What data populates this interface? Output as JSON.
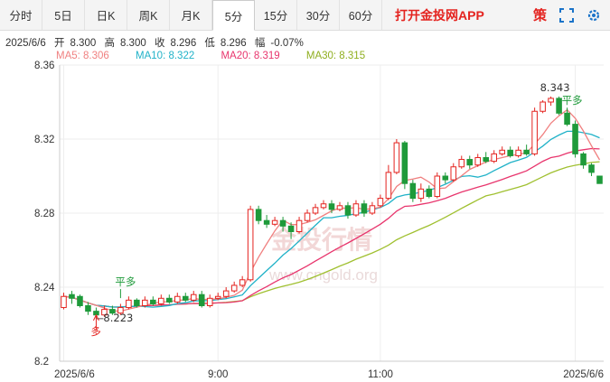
{
  "tabs": [
    {
      "label": "分时"
    },
    {
      "label": "5日"
    },
    {
      "label": "日K"
    },
    {
      "label": "周K"
    },
    {
      "label": "月K"
    },
    {
      "label": "5分",
      "active": true
    },
    {
      "label": "15分"
    },
    {
      "label": "30分"
    },
    {
      "label": "60分"
    }
  ],
  "promo": "打开金投网APP",
  "toolbar": {
    "strategy_label": "策",
    "icons": [
      "fullscreen-icon",
      "settings-icon"
    ]
  },
  "info": {
    "date": "2025/6/6",
    "open_label": "开",
    "open": "8.300",
    "high_label": "高",
    "high": "8.300",
    "close_label": "收",
    "close": "8.296",
    "low_label": "低",
    "low": "8.296",
    "change_label": "幅",
    "change": "-0.07%"
  },
  "ma": {
    "ma5": "MA5: 8.306",
    "ma10": "MA10: 8.322",
    "ma20": "MA20: 8.319",
    "ma30": "MA30: 8.315",
    "colors": {
      "ma5": "#f08080",
      "ma10": "#20b2c8",
      "ma20": "#e8356d",
      "ma30": "#a0c030"
    }
  },
  "watermark": {
    "text": "金投行情",
    "url": "www.cngold.org"
  },
  "chart_data": {
    "type": "candlestick",
    "ylim": [
      8.2,
      8.36
    ],
    "yticks": [
      "8.36",
      "8.32",
      "8.28",
      "8.24",
      "8.2"
    ],
    "xticks": [
      {
        "label": "2025/6/6",
        "index": 0
      },
      {
        "label": "9:00",
        "index": 19
      },
      {
        "label": "11:00",
        "index": 39
      },
      {
        "label": "2025/6/6",
        "index": 63
      }
    ],
    "up_color": "#e4231f",
    "down_color": "#1e9a3a",
    "candles": [
      [
        8.229,
        8.235,
        8.237,
        8.228
      ],
      [
        8.236,
        8.234,
        8.238,
        8.231
      ],
      [
        8.235,
        8.23,
        8.236,
        8.229
      ],
      [
        8.23,
        8.227,
        8.232,
        8.225
      ],
      [
        8.227,
        8.225,
        8.229,
        8.223
      ],
      [
        8.225,
        8.228,
        8.23,
        8.224
      ],
      [
        8.228,
        8.226,
        8.23,
        8.225
      ],
      [
        8.226,
        8.229,
        8.231,
        8.225
      ],
      [
        8.229,
        8.233,
        8.235,
        8.228
      ],
      [
        8.233,
        8.23,
        8.234,
        8.229
      ],
      [
        8.23,
        8.233,
        8.235,
        8.229
      ],
      [
        8.233,
        8.231,
        8.235,
        8.23
      ],
      [
        8.231,
        8.234,
        8.236,
        8.23
      ],
      [
        8.234,
        8.232,
        8.236,
        8.231
      ],
      [
        8.232,
        8.235,
        8.237,
        8.231
      ],
      [
        8.235,
        8.233,
        8.237,
        8.232
      ],
      [
        8.233,
        8.236,
        8.238,
        8.232
      ],
      [
        8.236,
        8.23,
        8.238,
        8.229
      ],
      [
        8.23,
        8.234,
        8.236,
        8.229
      ],
      [
        8.234,
        8.235,
        8.237,
        8.233
      ],
      [
        8.235,
        8.238,
        8.24,
        8.234
      ],
      [
        8.238,
        8.241,
        8.243,
        8.237
      ],
      [
        8.241,
        8.244,
        8.246,
        8.24
      ],
      [
        8.244,
        8.282,
        8.284,
        8.243
      ],
      [
        8.282,
        8.276,
        8.284,
        8.274
      ],
      [
        8.276,
        8.274,
        8.279,
        8.272
      ],
      [
        8.274,
        8.276,
        8.278,
        8.273
      ],
      [
        8.276,
        8.273,
        8.278,
        8.27
      ],
      [
        8.273,
        8.27,
        8.275,
        8.266
      ],
      [
        8.27,
        8.276,
        8.278,
        8.269
      ],
      [
        8.276,
        8.28,
        8.282,
        8.275
      ],
      [
        8.28,
        8.283,
        8.285,
        8.279
      ],
      [
        8.283,
        8.285,
        8.287,
        8.282
      ],
      [
        8.285,
        8.282,
        8.287,
        8.28
      ],
      [
        8.282,
        8.284,
        8.286,
        8.281
      ],
      [
        8.284,
        8.279,
        8.286,
        8.277
      ],
      [
        8.279,
        8.285,
        8.287,
        8.278
      ],
      [
        8.285,
        8.28,
        8.287,
        8.278
      ],
      [
        8.28,
        8.284,
        8.286,
        8.279
      ],
      [
        8.284,
        8.288,
        8.29,
        8.283
      ],
      [
        8.288,
        8.302,
        8.306,
        8.287
      ],
      [
        8.302,
        8.318,
        8.32,
        8.301
      ],
      [
        8.318,
        8.296,
        8.319,
        8.293
      ],
      [
        8.296,
        8.288,
        8.298,
        8.286
      ],
      [
        8.288,
        8.293,
        8.296,
        8.286
      ],
      [
        8.293,
        8.289,
        8.295,
        8.288
      ],
      [
        8.289,
        8.3,
        8.302,
        8.288
      ],
      [
        8.3,
        8.298,
        8.302,
        8.296
      ],
      [
        8.298,
        8.305,
        8.307,
        8.297
      ],
      [
        8.305,
        8.309,
        8.311,
        8.304
      ],
      [
        8.309,
        8.306,
        8.311,
        8.304
      ],
      [
        8.306,
        8.31,
        8.312,
        8.305
      ],
      [
        8.31,
        8.308,
        8.313,
        8.307
      ],
      [
        8.308,
        8.312,
        8.314,
        8.307
      ],
      [
        8.312,
        8.314,
        8.316,
        8.311
      ],
      [
        8.314,
        8.311,
        8.316,
        8.31
      ],
      [
        8.311,
        8.314,
        8.316,
        8.31
      ],
      [
        8.314,
        8.312,
        8.317,
        8.311
      ],
      [
        8.312,
        8.335,
        8.337,
        8.311
      ],
      [
        8.335,
        8.34,
        8.341,
        8.334
      ],
      [
        8.34,
        8.342,
        8.343,
        8.338
      ],
      [
        8.342,
        8.334,
        8.343,
        8.333
      ],
      [
        8.334,
        8.328,
        8.336,
        8.327
      ],
      [
        8.328,
        8.312,
        8.33,
        8.31
      ],
      [
        8.312,
        8.306,
        8.313,
        8.304
      ],
      [
        8.306,
        8.302,
        8.307,
        8.3
      ],
      [
        8.3,
        8.296,
        8.3,
        8.296
      ]
    ],
    "annotations": [
      {
        "text": "8.343",
        "index": 60,
        "value": 8.343
      },
      {
        "text": "8.223",
        "index": 4,
        "value": 8.223
      },
      {
        "text": "平多",
        "index": 7,
        "value": 8.238
      },
      {
        "text": "多",
        "index": 4,
        "value": 8.216
      },
      {
        "text": "平多",
        "index": 62,
        "value": 8.336
      }
    ]
  }
}
